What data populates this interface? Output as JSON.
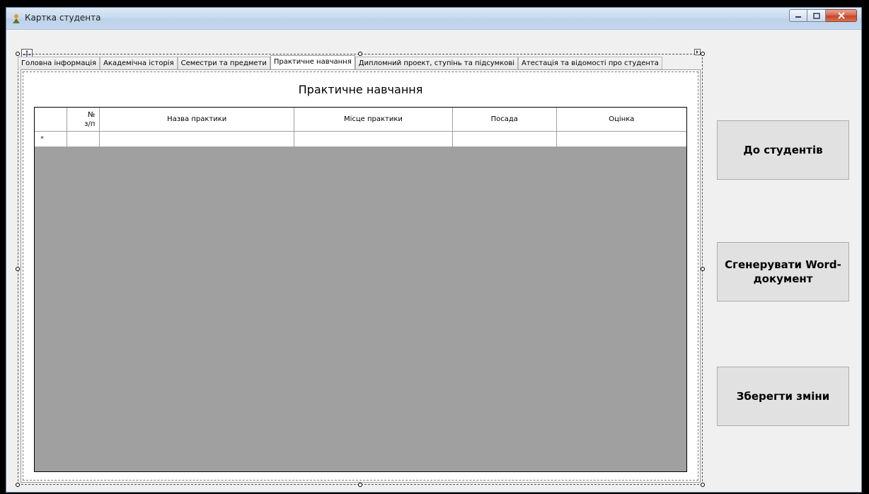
{
  "window": {
    "title": "Картка студента"
  },
  "tabs": [
    {
      "label": "Головна інформація"
    },
    {
      "label": "Академічна історія"
    },
    {
      "label": "Семестри та предмети"
    },
    {
      "label": "Практичне навчання",
      "active": true
    },
    {
      "label": "Дипломний проект, ступінь та підсумкові"
    },
    {
      "label": "Атестація та відомості про студента"
    }
  ],
  "page": {
    "section_title": "Практичне навчання"
  },
  "grid": {
    "columns": [
      {
        "label": "№\nз/п"
      },
      {
        "label": "Назва практики"
      },
      {
        "label": "Місце практики"
      },
      {
        "label": "Посада"
      },
      {
        "label": "Оцінка"
      }
    ],
    "new_row_marker": "*"
  },
  "buttons": {
    "to_students": "До студентів",
    "generate_word": "Сгенерувати Word-документ",
    "save_changes": "Зберегти зміни"
  },
  "colors": {
    "grid_background": "#a0a0a0",
    "close_button": "#c4442a",
    "titlebar": "#c9dbef"
  }
}
